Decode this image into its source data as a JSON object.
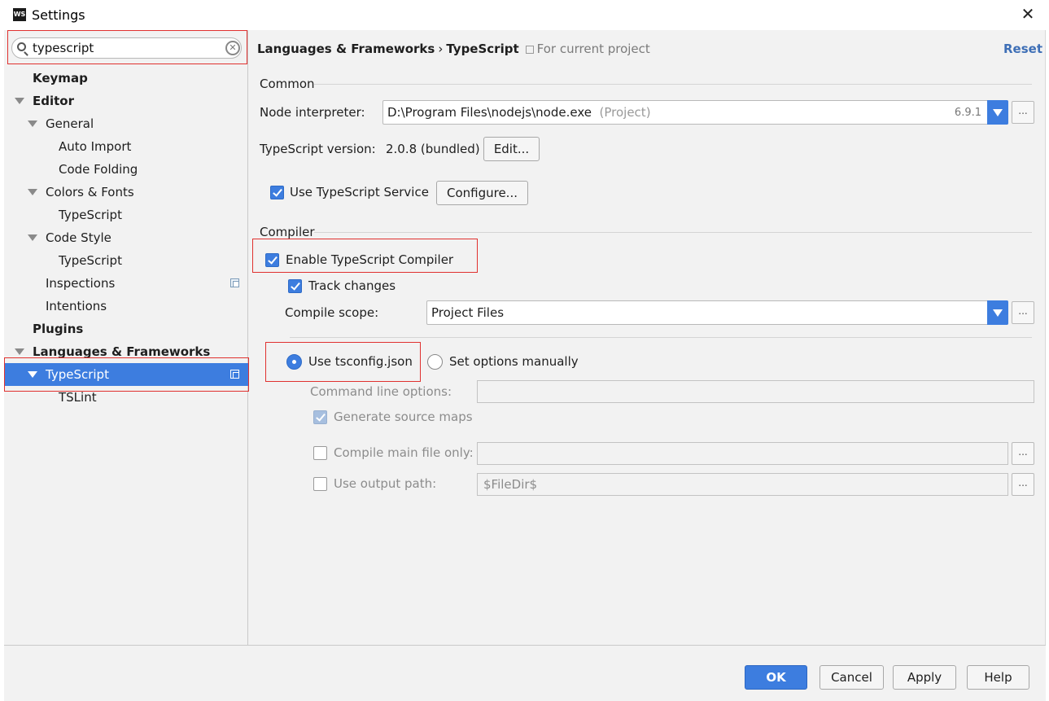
{
  "window": {
    "title": "Settings",
    "app_icon_text": "WS",
    "close_glyph": "✕"
  },
  "search": {
    "value": "typescript",
    "clear_glyph": "✕"
  },
  "tree": {
    "items": [
      {
        "label": "Keymap"
      },
      {
        "label": "Editor"
      },
      {
        "label": "General"
      },
      {
        "label": "Auto Import"
      },
      {
        "label": "Code Folding"
      },
      {
        "label": "Colors & Fonts"
      },
      {
        "label": "TypeScript"
      },
      {
        "label": "Code Style"
      },
      {
        "label": "TypeScript"
      },
      {
        "label": "Inspections"
      },
      {
        "label": "Intentions"
      },
      {
        "label": "Plugins"
      },
      {
        "label": "Languages & Frameworks"
      },
      {
        "label": "TypeScript"
      },
      {
        "label": "TSLint"
      }
    ]
  },
  "header": {
    "crumb_parent": "Languages & Frameworks",
    "crumb_sep": "›",
    "crumb_current": "TypeScript",
    "scope": "For current project",
    "reset": "Reset"
  },
  "common": {
    "section_title": "Common",
    "node_label": "Node interpreter:",
    "node_value": "D:\\Program Files\\nodejs\\node.exe",
    "node_suffix": "(Project)",
    "node_version": "6.9.1",
    "ts_version_label": "TypeScript version:",
    "ts_version_value": "2.0.8 (bundled)",
    "edit_button": "Edit...",
    "use_service_label": "Use TypeScript Service",
    "use_service_checked": true,
    "configure_button": "Configure..."
  },
  "compiler": {
    "section_title": "Compiler",
    "enable_label": "Enable TypeScript Compiler",
    "enable_checked": true,
    "track_label": "Track changes",
    "track_checked": true,
    "scope_label": "Compile scope:",
    "scope_value": "Project Files",
    "tsconfig_label": "Use tsconfig.json",
    "tsconfig_selected": true,
    "manual_label": "Set options manually",
    "cmd_options_label": "Command line options:",
    "cmd_options_value": "",
    "source_maps_label": "Generate source maps",
    "source_maps_checked": true,
    "main_file_label": "Compile main file only:",
    "main_file_value": "",
    "output_path_label": "Use output path:",
    "output_path_value": "$FileDir$"
  },
  "ellipsis": "...",
  "footer": {
    "ok": "OK",
    "cancel": "Cancel",
    "apply": "Apply",
    "help": "Help"
  },
  "colors": {
    "accent": "#3d7ddf",
    "highlight_box": "#e0312f",
    "link": "#3e6fb6"
  }
}
